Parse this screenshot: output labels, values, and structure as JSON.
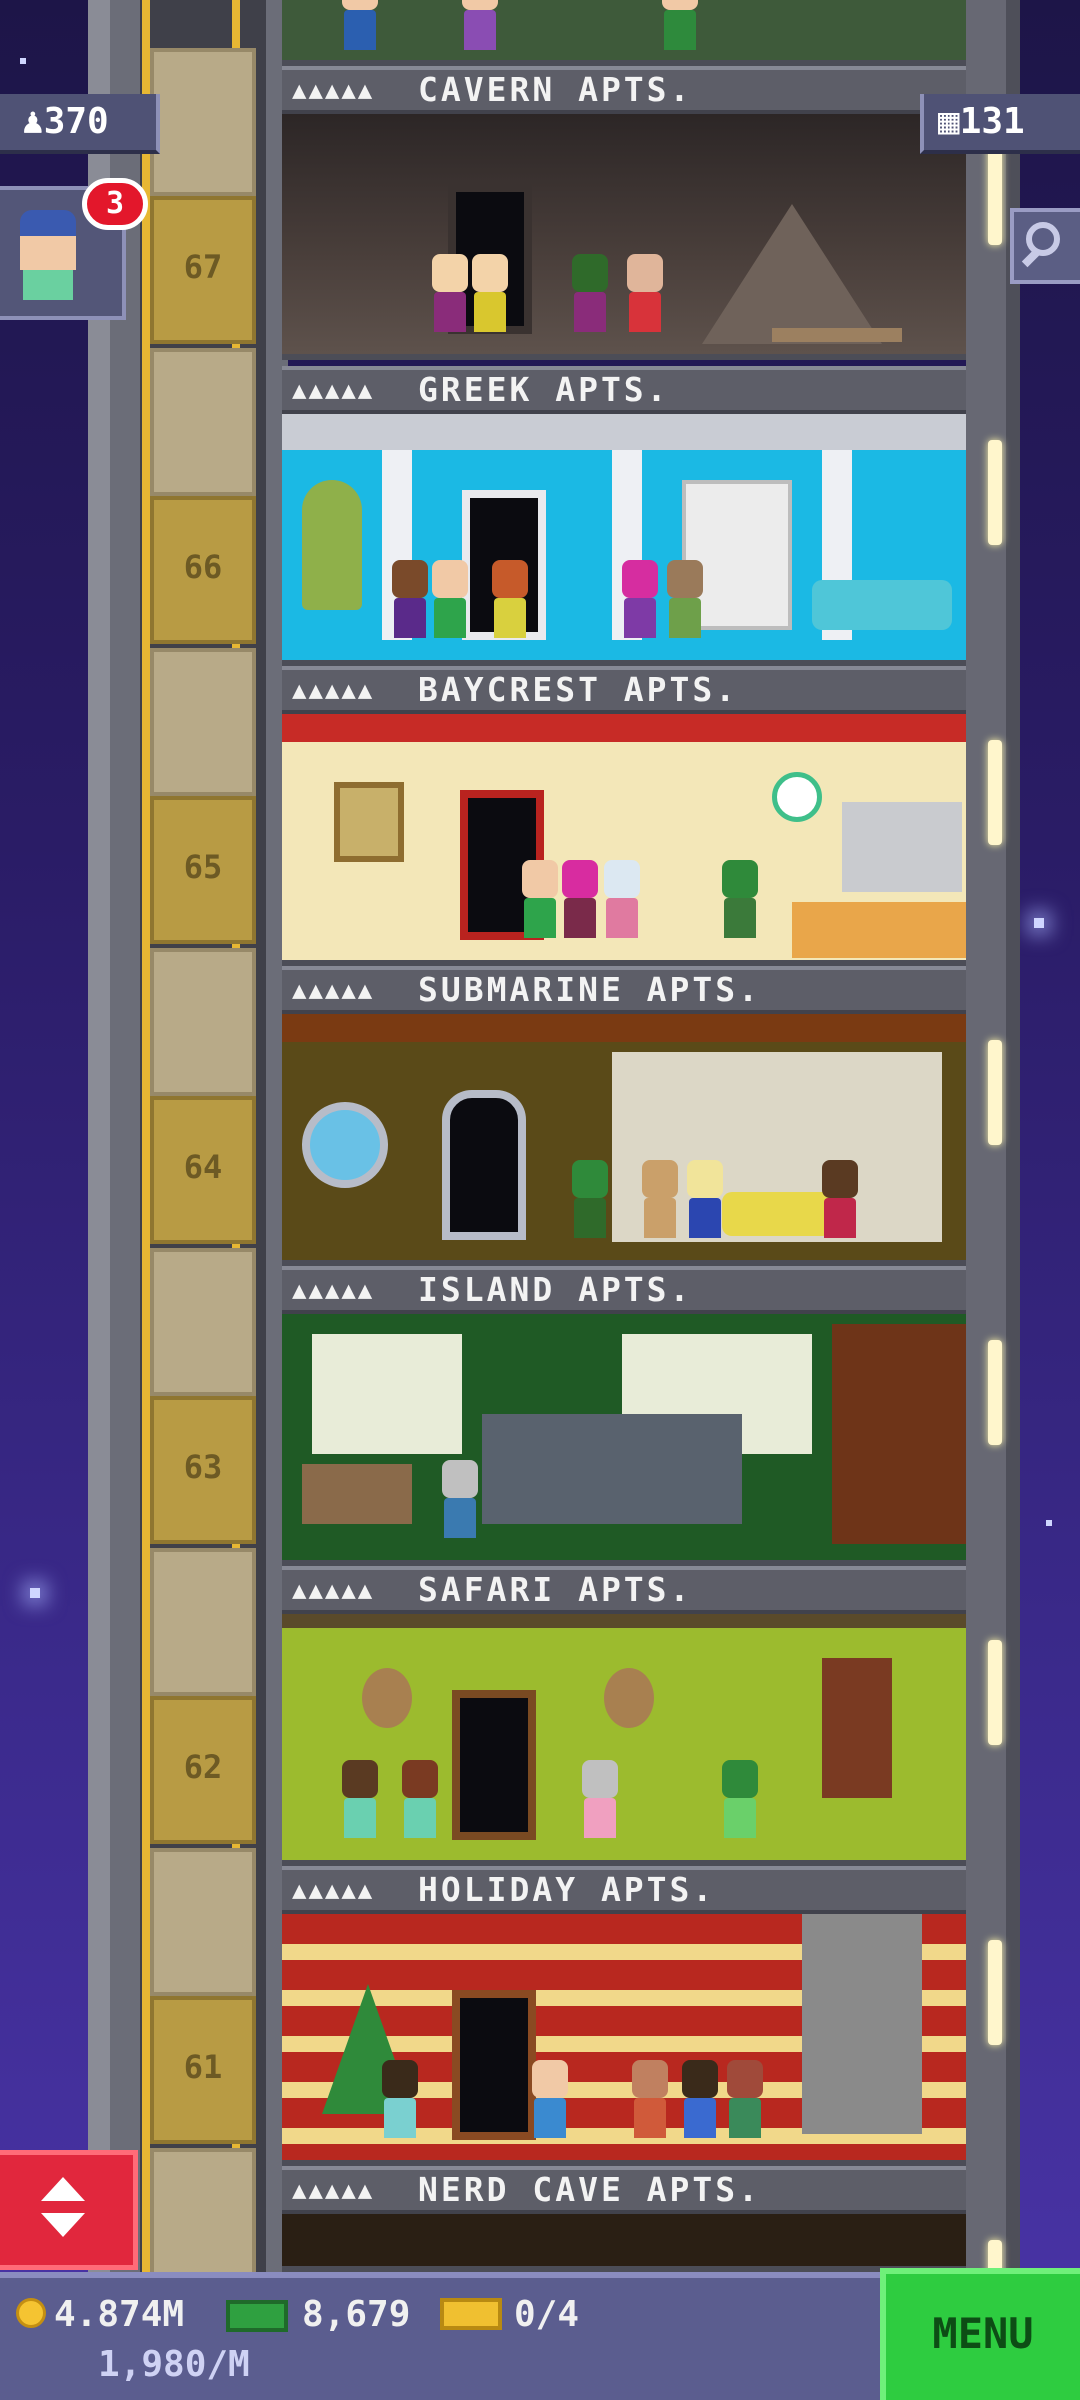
{
  "hud": {
    "population": "370",
    "floors_count": "131",
    "notification_count": "3",
    "coins": "4.874M",
    "bux": "8,679",
    "tickets": "0/4",
    "income_rate": "1,980/M",
    "menu_label": "MENU"
  },
  "floor_numbers": [
    "67",
    "66",
    "65",
    "64",
    "63",
    "62",
    "61"
  ],
  "floors": [
    {
      "stars": "▲▲▲▲▲",
      "name": "CAVERN APTS."
    },
    {
      "stars": "▲▲▲▲▲",
      "name": "GREEK APTS."
    },
    {
      "stars": "▲▲▲▲▲",
      "name": "BAYCREST APTS."
    },
    {
      "stars": "▲▲▲▲▲",
      "name": "SUBMARINE APTS."
    },
    {
      "stars": "▲▲▲▲▲",
      "name": "ISLAND APTS."
    },
    {
      "stars": "▲▲▲▲▲",
      "name": "SAFARI APTS."
    },
    {
      "stars": "▲▲▲▲▲",
      "name": "HOLIDAY APTS."
    },
    {
      "stars": "▲▲▲▲▲",
      "name": "NERD CAVE APTS."
    }
  ],
  "icons": {
    "population": "person-icon",
    "floors": "building-icon",
    "search": "magnifier-icon",
    "elevator": "up-down-arrows-icon",
    "coins": "coin-icon",
    "bux": "bux-cash-icon",
    "tickets": "ticket-icon"
  },
  "colors": {
    "menu_button": "#2ecc40",
    "elevator_button": "#e1273d",
    "notification": "#e3172b"
  }
}
